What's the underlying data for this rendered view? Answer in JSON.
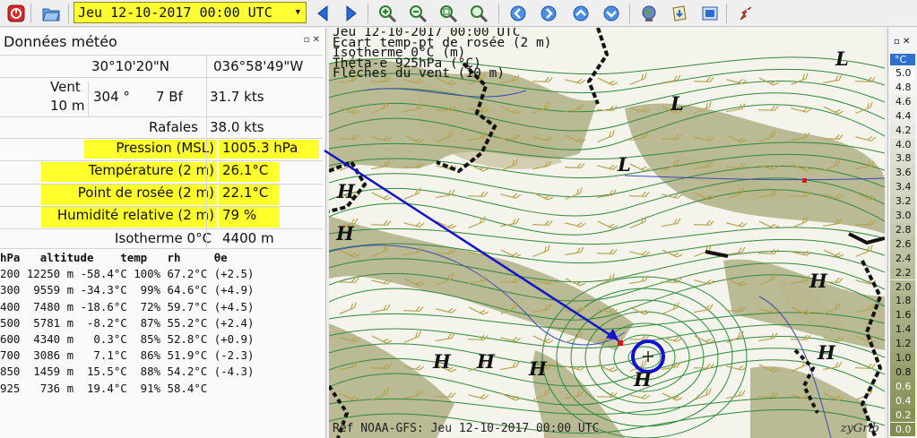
{
  "toolbar": {
    "date_value": "Jeu 12-10-2017 00:00 UTC",
    "colors": {
      "highlight": "#ffff33",
      "nav_blue": "#2a6ad8"
    },
    "buttons": [
      "close-icon",
      "open-file-icon",
      "previous-icon",
      "next-icon",
      "zoom-in-icon",
      "zoom-out-icon",
      "zoom-select-icon",
      "zoom-all-icon",
      "go-left-icon",
      "go-right-icon",
      "go-up-icon",
      "go-down-icon",
      "globe-icon",
      "download-icon",
      "gribfile-icon",
      "rocket-icon"
    ]
  },
  "panel": {
    "title": "Données météo",
    "latitude": "30°10'20\"N",
    "longitude": "036°58'49\"W",
    "wind_label_1": "Vent",
    "wind_label_2": "10 m",
    "wind_dir": "304 °",
    "wind_bf": "7 Bf",
    "wind_speed": "31.7  kts",
    "gust_label": "Rafales",
    "gust_value": "38.0  kts",
    "pressure_label": "Pression (MSL)",
    "pressure_value": "1005.3 hPa",
    "temp_label": "Température (2 m)",
    "temp_value": "26.1°C",
    "dew_label": "Point de rosée (2 m)",
    "dew_value": "22.1°C",
    "rh_label": "Humidité relative (2 m)",
    "rh_value": "79 %",
    "iso_label": "Isotherme 0°C",
    "iso_value": "4400 m"
  },
  "sounding": {
    "header": [
      "hPa",
      "altitude",
      "temp",
      "rh",
      "θe"
    ],
    "rows": [
      [
        "200",
        "12250 m",
        "-58.4°C",
        "100%",
        "67.2°C (+2.5)"
      ],
      [
        "300",
        " 9559 m",
        "-34.3°C",
        " 99%",
        "64.6°C (+4.9)"
      ],
      [
        "400",
        " 7480 m",
        "-18.6°C",
        " 72%",
        "59.7°C (+4.5)"
      ],
      [
        "500",
        " 5781 m",
        " -8.2°C",
        " 87%",
        "55.2°C (+2.4)"
      ],
      [
        "600",
        " 4340 m",
        "  0.3°C",
        " 85%",
        "52.8°C (+0.9)"
      ],
      [
        "700",
        " 3086 m",
        "  7.1°C",
        " 86%",
        "51.9°C (-2.3)"
      ],
      [
        "850",
        " 1459 m",
        " 15.5°C",
        " 88%",
        "54.2°C (-4.3)"
      ],
      [
        "925",
        "  736 m",
        " 19.4°C",
        " 91%",
        "58.4°C"
      ]
    ]
  },
  "map": {
    "header": [
      "Jeu 12-10-2017 00:00 UTC",
      "Ecart temp-pt de rosée (2 m)",
      "Isotherme 0°C (m)",
      "Théta-e 925hPa (°C)",
      "Flèches du vent (10 m)"
    ],
    "footer": "Ref NOAA-GFS: Jeu 12-10-2017 00:00 UTC",
    "credit": "zyGrib",
    "pressure_marks": [
      {
        "label": "L",
        "name": "low-marker-1"
      },
      {
        "label": "L",
        "name": "low-marker-2"
      },
      {
        "label": "L",
        "name": "low-marker-3"
      },
      {
        "label": "H",
        "name": "high-marker-1"
      },
      {
        "label": "H",
        "name": "high-marker-2"
      },
      {
        "label": "H",
        "name": "high-marker-3"
      },
      {
        "label": "H",
        "name": "high-marker-4"
      },
      {
        "label": "H",
        "name": "high-marker-5"
      },
      {
        "label": "H",
        "name": "high-marker-6"
      },
      {
        "label": "H",
        "name": "high-marker-7"
      },
      {
        "label": "H",
        "name": "high-marker-8"
      }
    ]
  },
  "scale": {
    "unit": "°C",
    "values": [
      "5.0",
      "4.8",
      "4.6",
      "4.4",
      "4.2",
      "4.0",
      "3.8",
      "3.6",
      "3.4",
      "3.2",
      "3.0",
      "2.8",
      "2.6",
      "2.4",
      "2.2",
      "2.0",
      "1.8",
      "1.6",
      "1.4",
      "1.2",
      "1.0",
      "0.8",
      "0.6",
      "0.4",
      "0.2",
      "0.0"
    ]
  }
}
